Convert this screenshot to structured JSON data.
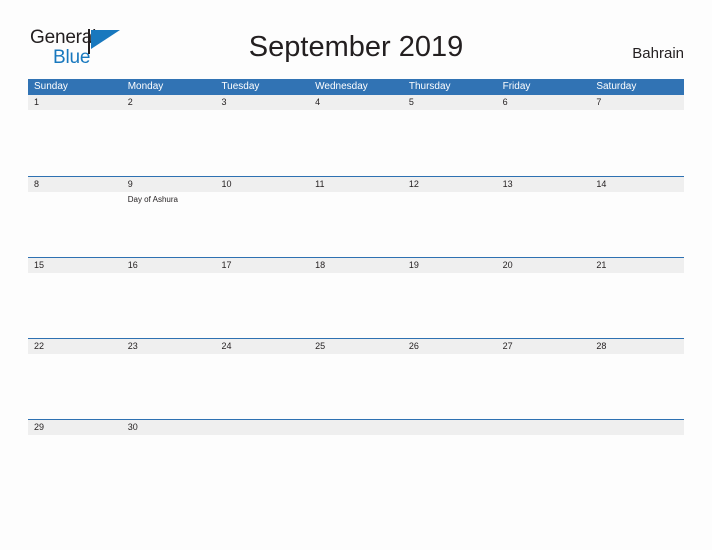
{
  "brand": {
    "name_part1": "General",
    "name_part2": "Blue",
    "flag_icon": "general-blue-flag-logo",
    "accent_color": "#1878be"
  },
  "header": {
    "title": "September 2019",
    "country": "Bahrain"
  },
  "theme": {
    "header_blue": "#3173b4",
    "separator_blue": "#2e71b2",
    "strip_gray": "#efefef",
    "text": "#231f20",
    "page_background": "#fdfdfd"
  },
  "calendar": {
    "month": "September",
    "year": "2019",
    "day_headers": [
      "Sunday",
      "Monday",
      "Tuesday",
      "Wednesday",
      "Thursday",
      "Friday",
      "Saturday"
    ],
    "weeks": [
      {
        "days": [
          {
            "num": "1",
            "events": []
          },
          {
            "num": "2",
            "events": []
          },
          {
            "num": "3",
            "events": []
          },
          {
            "num": "4",
            "events": []
          },
          {
            "num": "5",
            "events": []
          },
          {
            "num": "6",
            "events": []
          },
          {
            "num": "7",
            "events": []
          }
        ]
      },
      {
        "days": [
          {
            "num": "8",
            "events": []
          },
          {
            "num": "9",
            "events": [
              "Day of Ashura"
            ]
          },
          {
            "num": "10",
            "events": []
          },
          {
            "num": "11",
            "events": []
          },
          {
            "num": "12",
            "events": []
          },
          {
            "num": "13",
            "events": []
          },
          {
            "num": "14",
            "events": []
          }
        ]
      },
      {
        "days": [
          {
            "num": "15",
            "events": []
          },
          {
            "num": "16",
            "events": []
          },
          {
            "num": "17",
            "events": []
          },
          {
            "num": "18",
            "events": []
          },
          {
            "num": "19",
            "events": []
          },
          {
            "num": "20",
            "events": []
          },
          {
            "num": "21",
            "events": []
          }
        ]
      },
      {
        "days": [
          {
            "num": "22",
            "events": []
          },
          {
            "num": "23",
            "events": []
          },
          {
            "num": "24",
            "events": []
          },
          {
            "num": "25",
            "events": []
          },
          {
            "num": "26",
            "events": []
          },
          {
            "num": "27",
            "events": []
          },
          {
            "num": "28",
            "events": []
          }
        ]
      },
      {
        "days": [
          {
            "num": "29",
            "events": []
          },
          {
            "num": "30",
            "events": []
          },
          {
            "num": "",
            "events": []
          },
          {
            "num": "",
            "events": []
          },
          {
            "num": "",
            "events": []
          },
          {
            "num": "",
            "events": []
          },
          {
            "num": "",
            "events": []
          }
        ]
      }
    ]
  }
}
